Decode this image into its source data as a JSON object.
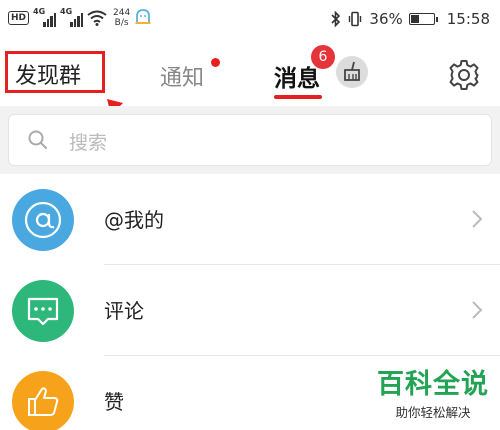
{
  "status_bar": {
    "hd": "HD",
    "sig1_gen": "4G",
    "sig2_gen": "4G",
    "net_speed_value": "244",
    "net_speed_unit": "B/s",
    "battery": "36%",
    "battery_level": 0.36,
    "time": "15:58"
  },
  "header": {
    "discover_groups": "发现群",
    "tab_notify": "通知",
    "tab_messages": "消息",
    "messages_badge": "6"
  },
  "search": {
    "placeholder": "搜索"
  },
  "list": {
    "items": [
      {
        "label": "@我的",
        "icon": "at-icon",
        "color": "#4aa8e0"
      },
      {
        "label": "评论",
        "icon": "comment-icon",
        "color": "#2db77b"
      },
      {
        "label": "赞",
        "icon": "thumbs-up-icon",
        "color": "#f7a21b"
      }
    ]
  },
  "watermark": {
    "title": "百科全说",
    "subtitle": "助你轻松解决"
  },
  "colors": {
    "accent_red": "#e5201f",
    "badge_red": "#e5343a",
    "watermark_green": "#23a455"
  }
}
